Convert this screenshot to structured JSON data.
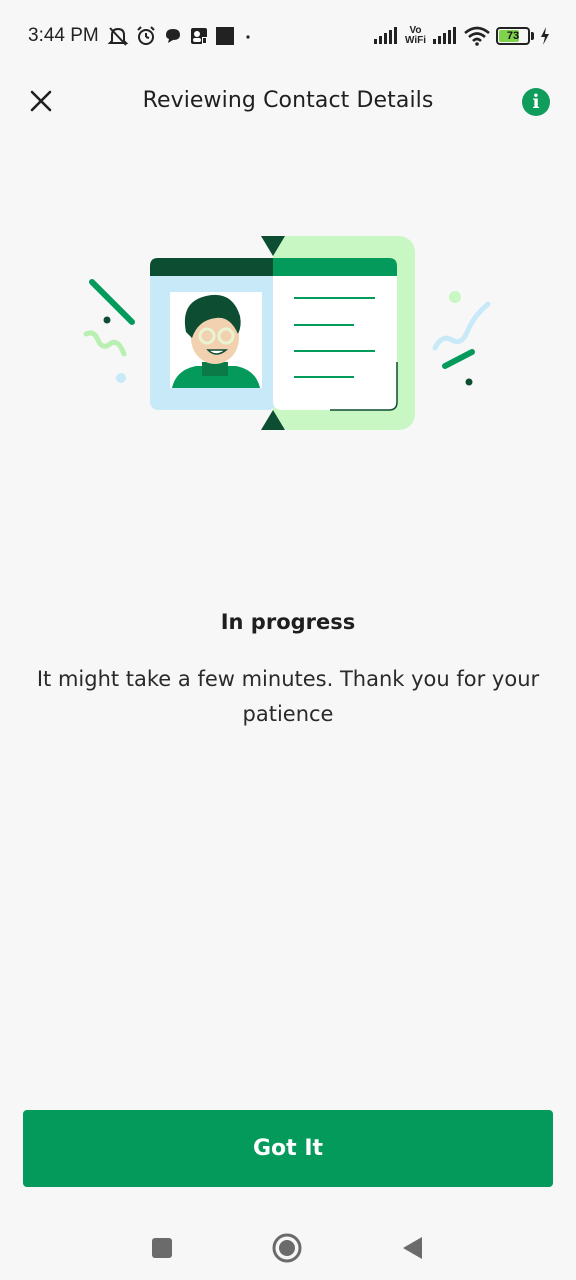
{
  "status_bar": {
    "time": "3:44 PM",
    "icons_left": [
      "muted-bell-icon",
      "alarm-icon",
      "chat-bubble-icon",
      "contact-card-icon",
      "square-notification-icon",
      "dot-icon"
    ],
    "vowifi_top": "Vo",
    "vowifi_bottom": "WiFi",
    "battery_level": "73",
    "battery_fraction": 0.73,
    "icons_right": [
      "signal-icon",
      "vowifi-icon",
      "signal-icon",
      "wifi-icon",
      "battery-icon",
      "charging-icon"
    ]
  },
  "header": {
    "title": "Reviewing Contact Details",
    "close_icon": "close-icon",
    "info_icon": "info-icon",
    "info_glyph": "i"
  },
  "illustration": {
    "name": "contact-card-illustration"
  },
  "content": {
    "status_title": "In progress",
    "status_message": "It might take a few minutes. Thank you for your patience"
  },
  "actions": {
    "primary_label": "Got It"
  },
  "nav": {
    "recents_icon": "square-recents-icon",
    "home_icon": "circle-home-icon",
    "back_icon": "triangle-back-icon"
  },
  "colors": {
    "accent": "#039a5c",
    "dark_green": "#0d4d31",
    "light_green": "#c9f7c3",
    "light_blue": "#c8e9f8",
    "background": "#f7f7f7"
  }
}
